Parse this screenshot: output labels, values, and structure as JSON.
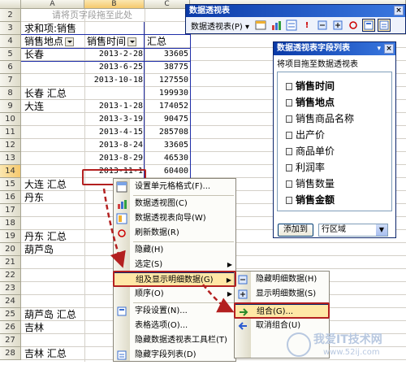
{
  "columns": [
    "A",
    "B",
    "C"
  ],
  "rows": [
    {
      "num": "2",
      "a": "请将页字段拖至此处",
      "b": "",
      "c": "",
      "type": "hint"
    },
    {
      "num": "3",
      "a": "求和项:销售",
      "b": "",
      "c": "",
      "type": "head"
    },
    {
      "num": "4",
      "a": "销售地点",
      "b": "销售时间",
      "c": "汇总",
      "type": "fieldrow"
    },
    {
      "num": "5",
      "a": "长春",
      "b": "2013-2-28",
      "c": "33605"
    },
    {
      "num": "6",
      "a": "",
      "b": "2013-6-25",
      "c": "38775"
    },
    {
      "num": "7",
      "a": "",
      "b": "2013-10-18",
      "c": "127550"
    },
    {
      "num": "8",
      "a": "长春 汇总",
      "b": "",
      "c": "199930"
    },
    {
      "num": "9",
      "a": "大连",
      "b": "2013-1-28",
      "c": "174052"
    },
    {
      "num": "10",
      "a": "",
      "b": "2013-3-19",
      "c": "90475"
    },
    {
      "num": "11",
      "a": "",
      "b": "2013-4-15",
      "c": "285708"
    },
    {
      "num": "12",
      "a": "",
      "b": "2013-8-24",
      "c": "33605"
    },
    {
      "num": "13",
      "a": "",
      "b": "2013-8-29",
      "c": "46530"
    },
    {
      "num": "14",
      "a": "",
      "b": "2013-11-1",
      "c": "60400",
      "selected": true
    },
    {
      "num": "15",
      "a": "大连 汇总",
      "b": "",
      "c": ""
    },
    {
      "num": "16",
      "a": "丹东",
      "b": "2",
      "c": ""
    },
    {
      "num": "17",
      "a": "",
      "b": "2",
      "c": ""
    },
    {
      "num": "18",
      "a": "",
      "b": "20",
      "c": ""
    },
    {
      "num": "19",
      "a": "丹东 汇总",
      "b": "",
      "c": ""
    },
    {
      "num": "20",
      "a": "葫芦岛",
      "b": "201",
      "c": ""
    },
    {
      "num": "21",
      "a": "",
      "b": "20",
      "c": ""
    },
    {
      "num": "22",
      "a": "",
      "b": "2013",
      "c": ""
    },
    {
      "num": "23",
      "a": "",
      "b": "2013",
      "c": ""
    },
    {
      "num": "24",
      "a": "",
      "b": "2013",
      "c": ""
    },
    {
      "num": "25",
      "a": "葫芦岛 汇总",
      "b": "",
      "c": ""
    },
    {
      "num": "26",
      "a": "吉林",
      "b": "",
      "c": ""
    },
    {
      "num": "27",
      "a": "",
      "b": "",
      "c": ""
    },
    {
      "num": "28",
      "a": "吉林 汇总",
      "b": "",
      "c": ""
    }
  ],
  "pivot_toolbar": {
    "title": "数据透视表",
    "menu_label": "数据透视表(P) ▾",
    "close": "×"
  },
  "field_list": {
    "title": "数据透视表字段列表",
    "subtitle": "将项目拖至数据透视表",
    "close": "×",
    "fields": [
      {
        "label": "销售时间",
        "bold": true
      },
      {
        "label": "销售地点",
        "bold": true
      },
      {
        "label": "销售商品名称",
        "bold": false
      },
      {
        "label": "出产价",
        "bold": false
      },
      {
        "label": "商品单价",
        "bold": false
      },
      {
        "label": "利润率",
        "bold": false
      },
      {
        "label": "销售数量",
        "bold": false
      },
      {
        "label": "销售金额",
        "bold": true
      }
    ],
    "add_button": "添加到",
    "area_value": "行区域"
  },
  "context_menu": {
    "items": [
      {
        "label": "设置单元格格式(F)...",
        "icon": "format-cells-icon"
      },
      {
        "label": "数据透视图(C)",
        "icon": "pivot-chart-icon"
      },
      {
        "label": "数据透视表向导(W)",
        "icon": "pivot-wizard-icon"
      },
      {
        "label": "刷新数据(R)",
        "icon": "refresh-icon"
      },
      {
        "label": "隐藏(H)",
        "icon": ""
      },
      {
        "label": "选定(S)",
        "icon": "",
        "sub": true
      },
      {
        "label": "组及显示明细数据(G)",
        "icon": "",
        "sub": true,
        "hl": true
      },
      {
        "label": "顺序(O)",
        "icon": "",
        "sub": true
      },
      {
        "label": "字段设置(N)...",
        "icon": "field-settings-icon"
      },
      {
        "label": "表格选项(O)...",
        "icon": ""
      },
      {
        "label": "隐藏数据透视表工具栏(T)",
        "icon": ""
      },
      {
        "label": "隐藏字段列表(D)",
        "icon": "field-list-icon"
      }
    ]
  },
  "submenu": {
    "items": [
      {
        "label": "隐藏明细数据(H)",
        "icon": "hide-detail-icon"
      },
      {
        "label": "显示明细数据(S)",
        "icon": "show-detail-icon"
      },
      {
        "label": "组合(G)...",
        "icon": "group-icon",
        "hl": true
      },
      {
        "label": "取消组合(U)",
        "icon": "ungroup-icon"
      }
    ]
  },
  "watermark": {
    "line1": "我爱IT技术网",
    "line2": "www.52ij.com"
  },
  "colors": {
    "selection_red": "#b32020",
    "menu_highlight": "#ffe7a6",
    "pivot_border": "#1f2ea8"
  }
}
